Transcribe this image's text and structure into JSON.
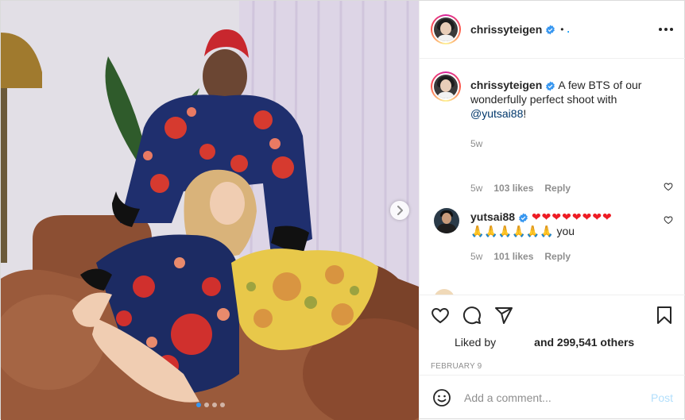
{
  "header": {
    "username": "chrissyteigen",
    "separator": "•",
    "follow_label": "."
  },
  "caption": {
    "username": "chrissyteigen",
    "text": " A few BTS of our wonderfully perfect shoot with ",
    "mention": "@yutsai88",
    "suffix": "!",
    "time": "5w"
  },
  "comments": [
    {
      "username": "",
      "text": "",
      "time": "5w",
      "likes": "103 likes",
      "reply_label": "Reply"
    },
    {
      "username": "yutsai88",
      "hearts": "❤❤❤❤❤❤❤❤",
      "hands": "🙏🙏🙏🙏🙏🙏",
      "text_tail": " you",
      "time": "5w",
      "likes": "101 likes",
      "reply_label": "Reply"
    }
  ],
  "likes": {
    "prefix": "Liked by",
    "count_text": "and 299,541 others"
  },
  "date": "FEBRUARY 9",
  "add_comment": {
    "placeholder": "Add a comment...",
    "post_label": "Post"
  },
  "carousel": {
    "total": 4,
    "active_index": 0
  },
  "colors": {
    "accent": "#0095f6",
    "verified": "#3897f0",
    "post_disabled": "#b2dffc",
    "heart_red": "#ed1c24"
  }
}
